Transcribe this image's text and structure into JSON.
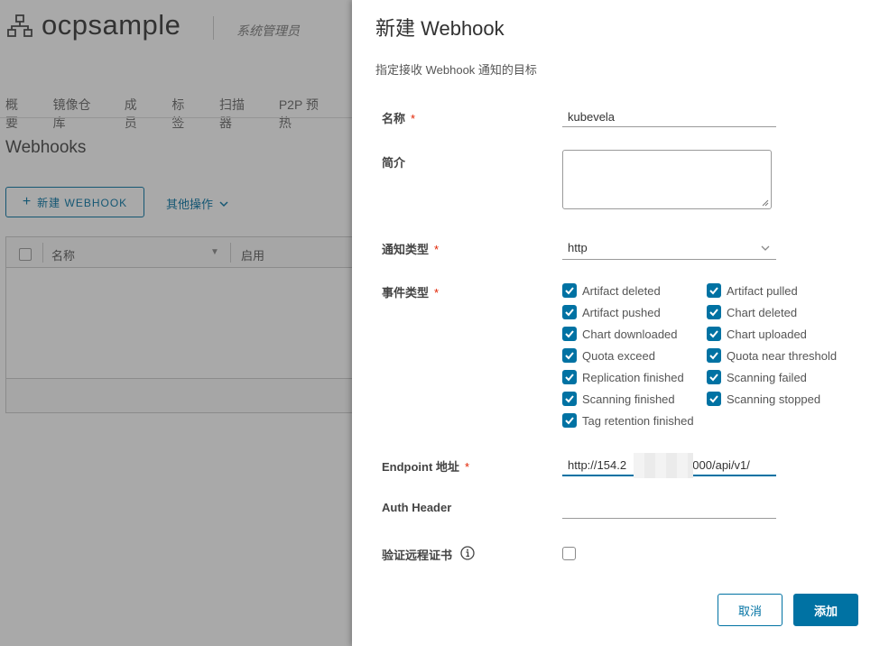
{
  "background": {
    "project_title": "ocpsample",
    "role": "系统管理员",
    "tabs": [
      "概要",
      "镜像仓库",
      "成员",
      "标签",
      "扫描器",
      "P2P 预热"
    ],
    "section_title": "Webhooks",
    "new_button": "新建 WEBHOOK",
    "more_ops": "其他操作",
    "table_columns": [
      "名称",
      "启用"
    ]
  },
  "modal": {
    "title": "新建 Webhook",
    "subtitle": "指定接收 Webhook 通知的目标",
    "fields": {
      "name_label": "名称",
      "name_value": "kubevela",
      "desc_label": "简介",
      "notify_type_label": "通知类型",
      "notify_type_value": "http",
      "event_type_label": "事件类型",
      "endpoint_label": "Endpoint 地址",
      "endpoint_value_prefix": "http://154.2",
      "endpoint_value_suffix": "0000/api/v1/",
      "auth_header_label": "Auth Header",
      "verify_cert_label": "验证远程证书"
    },
    "required_mark": "*",
    "events": [
      {
        "label": "Artifact deleted",
        "checked": true
      },
      {
        "label": "Artifact pulled",
        "checked": true
      },
      {
        "label": "Artifact pushed",
        "checked": true
      },
      {
        "label": "Chart deleted",
        "checked": true
      },
      {
        "label": "Chart downloaded",
        "checked": true
      },
      {
        "label": "Chart uploaded",
        "checked": true
      },
      {
        "label": "Quota exceed",
        "checked": true
      },
      {
        "label": "Quota near threshold",
        "checked": true
      },
      {
        "label": "Replication finished",
        "checked": true
      },
      {
        "label": "Scanning failed",
        "checked": true
      },
      {
        "label": "Scanning finished",
        "checked": true
      },
      {
        "label": "Scanning stopped",
        "checked": true
      },
      {
        "label": "Tag retention finished",
        "checked": true
      }
    ],
    "buttons": {
      "cancel": "取消",
      "add": "添加"
    },
    "accent_color": "#0072a3",
    "required_color": "#e12200"
  }
}
